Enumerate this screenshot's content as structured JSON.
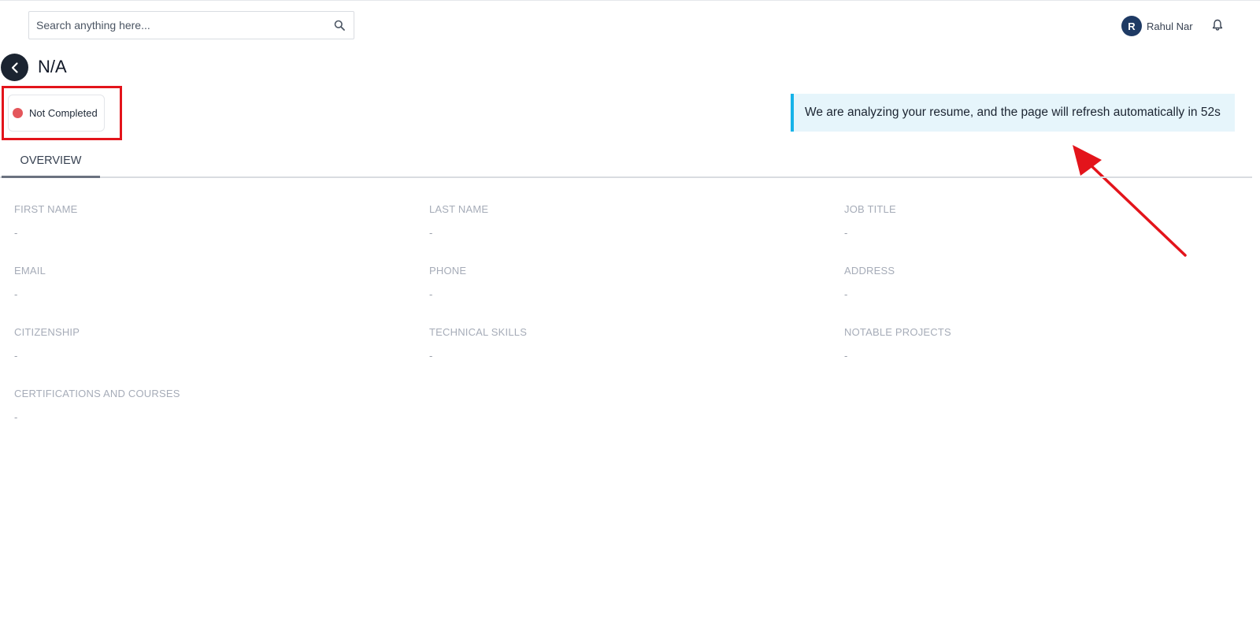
{
  "search": {
    "placeholder": "Search anything here..."
  },
  "user": {
    "initial": "R",
    "name": "Rahul Nar"
  },
  "header": {
    "title": "N/A"
  },
  "status": {
    "label": "Not Completed",
    "color": "#e4565b"
  },
  "banner": {
    "message": "We are analyzing your resume, and the page will refresh automatically in 52s"
  },
  "tabs": [
    {
      "label": "OVERVIEW"
    }
  ],
  "fields": [
    {
      "label": "FIRST NAME",
      "value": "-"
    },
    {
      "label": "LAST NAME",
      "value": "-"
    },
    {
      "label": "JOB TITLE",
      "value": "-"
    },
    {
      "label": "EMAIL",
      "value": "-"
    },
    {
      "label": "PHONE",
      "value": "-"
    },
    {
      "label": "ADDRESS",
      "value": "-"
    },
    {
      "label": "CITIZENSHIP",
      "value": "-"
    },
    {
      "label": "TECHNICAL SKILLS",
      "value": "-"
    },
    {
      "label": "NOTABLE PROJECTS",
      "value": "-"
    },
    {
      "label": "CERTIFICATIONS AND COURSES",
      "value": "-"
    }
  ],
  "colors": {
    "accent": "#16b3e8",
    "avatar": "#1e3a64",
    "annotation": "#e3141b"
  },
  "icons": [
    "search-icon",
    "bell-icon",
    "chevron-left-icon"
  ]
}
